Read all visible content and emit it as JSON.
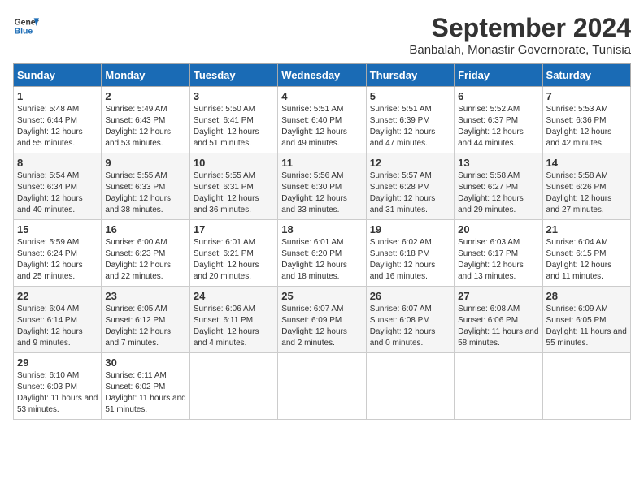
{
  "header": {
    "logo_line1": "General",
    "logo_line2": "Blue",
    "month": "September 2024",
    "location": "Banbalah, Monastir Governorate, Tunisia"
  },
  "days_of_week": [
    "Sunday",
    "Monday",
    "Tuesday",
    "Wednesday",
    "Thursday",
    "Friday",
    "Saturday"
  ],
  "weeks": [
    [
      {
        "day": "1",
        "sunrise": "5:48 AM",
        "sunset": "6:44 PM",
        "daylight": "12 hours and 55 minutes."
      },
      {
        "day": "2",
        "sunrise": "5:49 AM",
        "sunset": "6:43 PM",
        "daylight": "12 hours and 53 minutes."
      },
      {
        "day": "3",
        "sunrise": "5:50 AM",
        "sunset": "6:41 PM",
        "daylight": "12 hours and 51 minutes."
      },
      {
        "day": "4",
        "sunrise": "5:51 AM",
        "sunset": "6:40 PM",
        "daylight": "12 hours and 49 minutes."
      },
      {
        "day": "5",
        "sunrise": "5:51 AM",
        "sunset": "6:39 PM",
        "daylight": "12 hours and 47 minutes."
      },
      {
        "day": "6",
        "sunrise": "5:52 AM",
        "sunset": "6:37 PM",
        "daylight": "12 hours and 44 minutes."
      },
      {
        "day": "7",
        "sunrise": "5:53 AM",
        "sunset": "6:36 PM",
        "daylight": "12 hours and 42 minutes."
      }
    ],
    [
      {
        "day": "8",
        "sunrise": "5:54 AM",
        "sunset": "6:34 PM",
        "daylight": "12 hours and 40 minutes."
      },
      {
        "day": "9",
        "sunrise": "5:55 AM",
        "sunset": "6:33 PM",
        "daylight": "12 hours and 38 minutes."
      },
      {
        "day": "10",
        "sunrise": "5:55 AM",
        "sunset": "6:31 PM",
        "daylight": "12 hours and 36 minutes."
      },
      {
        "day": "11",
        "sunrise": "5:56 AM",
        "sunset": "6:30 PM",
        "daylight": "12 hours and 33 minutes."
      },
      {
        "day": "12",
        "sunrise": "5:57 AM",
        "sunset": "6:28 PM",
        "daylight": "12 hours and 31 minutes."
      },
      {
        "day": "13",
        "sunrise": "5:58 AM",
        "sunset": "6:27 PM",
        "daylight": "12 hours and 29 minutes."
      },
      {
        "day": "14",
        "sunrise": "5:58 AM",
        "sunset": "6:26 PM",
        "daylight": "12 hours and 27 minutes."
      }
    ],
    [
      {
        "day": "15",
        "sunrise": "5:59 AM",
        "sunset": "6:24 PM",
        "daylight": "12 hours and 25 minutes."
      },
      {
        "day": "16",
        "sunrise": "6:00 AM",
        "sunset": "6:23 PM",
        "daylight": "12 hours and 22 minutes."
      },
      {
        "day": "17",
        "sunrise": "6:01 AM",
        "sunset": "6:21 PM",
        "daylight": "12 hours and 20 minutes."
      },
      {
        "day": "18",
        "sunrise": "6:01 AM",
        "sunset": "6:20 PM",
        "daylight": "12 hours and 18 minutes."
      },
      {
        "day": "19",
        "sunrise": "6:02 AM",
        "sunset": "6:18 PM",
        "daylight": "12 hours and 16 minutes."
      },
      {
        "day": "20",
        "sunrise": "6:03 AM",
        "sunset": "6:17 PM",
        "daylight": "12 hours and 13 minutes."
      },
      {
        "day": "21",
        "sunrise": "6:04 AM",
        "sunset": "6:15 PM",
        "daylight": "12 hours and 11 minutes."
      }
    ],
    [
      {
        "day": "22",
        "sunrise": "6:04 AM",
        "sunset": "6:14 PM",
        "daylight": "12 hours and 9 minutes."
      },
      {
        "day": "23",
        "sunrise": "6:05 AM",
        "sunset": "6:12 PM",
        "daylight": "12 hours and 7 minutes."
      },
      {
        "day": "24",
        "sunrise": "6:06 AM",
        "sunset": "6:11 PM",
        "daylight": "12 hours and 4 minutes."
      },
      {
        "day": "25",
        "sunrise": "6:07 AM",
        "sunset": "6:09 PM",
        "daylight": "12 hours and 2 minutes."
      },
      {
        "day": "26",
        "sunrise": "6:07 AM",
        "sunset": "6:08 PM",
        "daylight": "12 hours and 0 minutes."
      },
      {
        "day": "27",
        "sunrise": "6:08 AM",
        "sunset": "6:06 PM",
        "daylight": "11 hours and 58 minutes."
      },
      {
        "day": "28",
        "sunrise": "6:09 AM",
        "sunset": "6:05 PM",
        "daylight": "11 hours and 55 minutes."
      }
    ],
    [
      {
        "day": "29",
        "sunrise": "6:10 AM",
        "sunset": "6:03 PM",
        "daylight": "11 hours and 53 minutes."
      },
      {
        "day": "30",
        "sunrise": "6:11 AM",
        "sunset": "6:02 PM",
        "daylight": "11 hours and 51 minutes."
      },
      null,
      null,
      null,
      null,
      null
    ]
  ]
}
